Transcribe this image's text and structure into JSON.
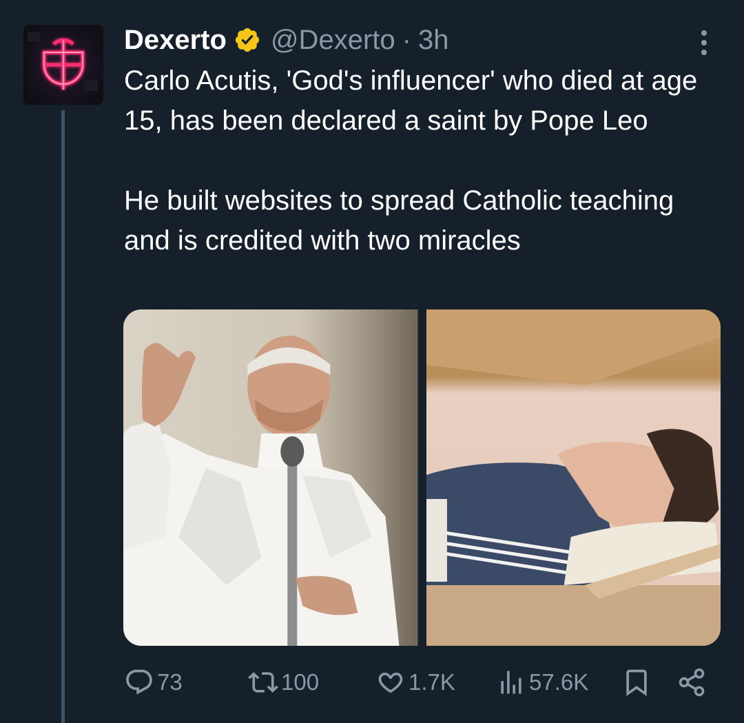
{
  "tweet": {
    "author": {
      "name": "Dexerto",
      "handle": "@Dexerto",
      "separator": "·",
      "time": "3h",
      "verified": true,
      "verified_color": "#f5c518"
    },
    "text_paragraph_1": "Carlo Acutis, 'God's influencer' who died at age 15, has been declared a saint by Pope Leo",
    "text_paragraph_2": "He built websites to spread Catholic teaching and is credited with two miracles",
    "media": [
      {
        "alt": "Pope Leo in white vestments speaking at a microphone with raised hand"
      },
      {
        "alt": "Carlo Acutis lying in a glass tomb wearing a blue jacket"
      }
    ],
    "metrics": {
      "replies": "73",
      "retweets": "100",
      "likes": "1.7K",
      "views": "57.6K"
    },
    "icons": [
      "more-icon",
      "reply-icon",
      "retweet-icon",
      "like-icon",
      "views-icon",
      "bookmark-icon",
      "share-icon"
    ]
  },
  "colors": {
    "background": "#15202b",
    "text": "#ffffff",
    "secondary_text": "#8b98a5",
    "thread_line": "#3d5466",
    "avatar_neon": "#ff2d6f"
  }
}
